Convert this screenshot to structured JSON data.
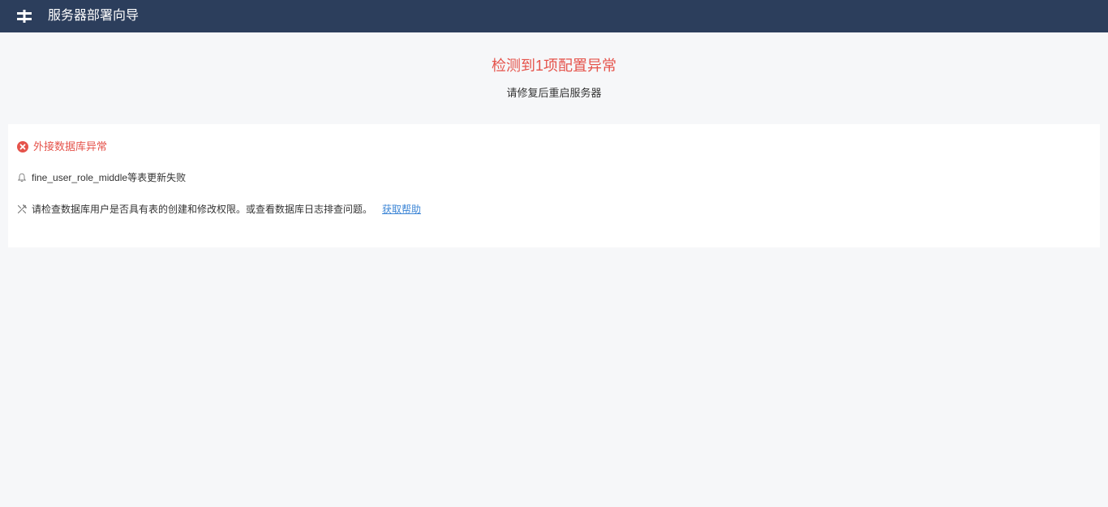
{
  "header": {
    "app_title": "服务器部署向导",
    "logo_icon": "grid-logo-icon",
    "background_color": "#2c3e5c"
  },
  "summary": {
    "title": "检测到1项配置异常",
    "subtitle": "请修复后重启服务器",
    "title_color": "#e5534b"
  },
  "error_card": {
    "status_icon": "error-circle-icon",
    "title": "外接数据库异常",
    "detail_icon": "bell-icon",
    "detail_text": "fine_user_role_middle等表更新失败",
    "suggestion_icon": "tools-icon",
    "suggestion_text": "请检查数据库用户是否具有表的创建和修改权限。或查看数据库日志排查问题。",
    "help_link": "获取帮助",
    "link_color": "#3d86d6"
  }
}
